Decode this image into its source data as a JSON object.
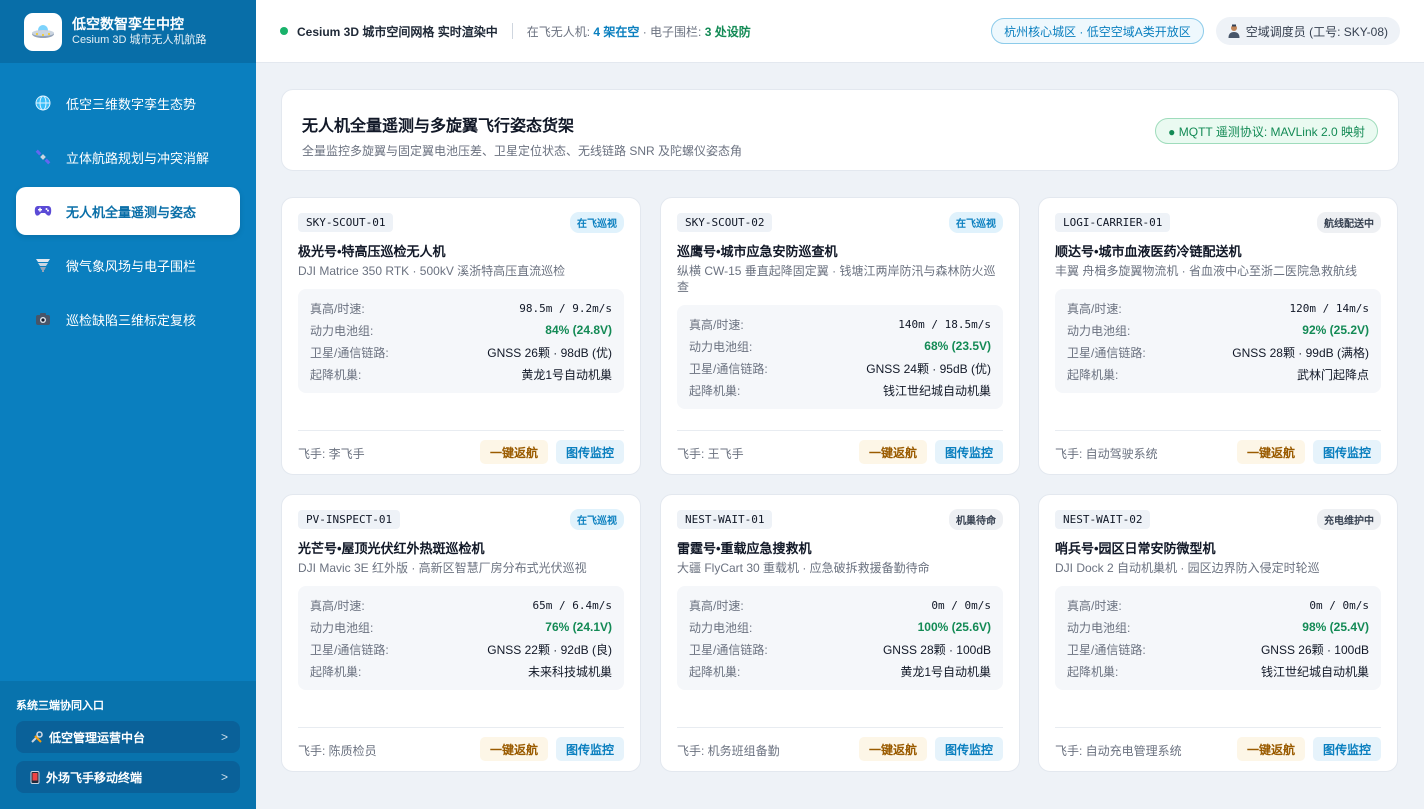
{
  "brand": {
    "title": "低空数智孪生中控",
    "subtitle": "Cesium 3D 城市无人机航路"
  },
  "nav": [
    {
      "label": "低空三维数字孪生态势",
      "icon": "globe-icon"
    },
    {
      "label": "立体航路规划与冲突消解",
      "icon": "satellite-icon"
    },
    {
      "label": "无人机全量遥测与姿态",
      "icon": "gamepad-icon",
      "active": true
    },
    {
      "label": "微气象风场与电子围栏",
      "icon": "tornado-icon"
    },
    {
      "label": "巡检缺陷三维标定复核",
      "icon": "camera-icon"
    }
  ],
  "side_bottom": {
    "title": "系统三端协同入口",
    "links": [
      {
        "label": "低空管理运营中台",
        "icon": "tools-icon",
        "arrow": ">"
      },
      {
        "label": "外场飞手移动终端",
        "icon": "phone-icon",
        "arrow": ">"
      }
    ]
  },
  "topbar": {
    "live_text": "Cesium 3D 城市空间网格 实时渲染中",
    "stat_prefix": "在飞无人机: ",
    "flying": "4 架在空",
    "stat_mid": " · 电子围栏: ",
    "fences": "3 处设防",
    "zone": "杭州核心城区 · 低空空域A类开放区",
    "user": "空域调度员 (工号: SKY-08)"
  },
  "header": {
    "title": "无人机全量遥测与多旋翼飞行姿态货架",
    "subtitle": "全量监控多旋翼与固定翼电池压差、卫星定位状态、无线链路 SNR 及陀螺仪姿态角",
    "protocol": "● MQTT 遥测协议: MAVLink 2.0 映射"
  },
  "labels": {
    "alt_speed": "真高/时速:",
    "battery": "动力电池组:",
    "link": "卫星/通信链路:",
    "dock": "起降机巢:",
    "rth": "一键返航",
    "video": "图传监控"
  },
  "drones": [
    {
      "code": "SKY-SCOUT-01",
      "status": "在飞巡视",
      "flying": true,
      "name": "极光号•特高压巡检无人机",
      "desc": "DJI Matrice 350 RTK · 500kV 溪浙特高压直流巡检",
      "alt_speed": "98.5m / 9.2m/s",
      "battery": "84% (24.8V)",
      "link": "GNSS 26颗 · 98dB (优)",
      "dock": "黄龙1号自动机巢",
      "pilot": "飞手: 李飞手"
    },
    {
      "code": "SKY-SCOUT-02",
      "status": "在飞巡视",
      "flying": true,
      "name": "巡鹰号•城市应急安防巡查机",
      "desc": "纵横 CW-15 垂直起降固定翼 · 钱塘江两岸防汛与森林防火巡查",
      "alt_speed": "140m / 18.5m/s",
      "battery": "68% (23.5V)",
      "link": "GNSS 24颗 · 95dB (优)",
      "dock": "钱江世纪城自动机巢",
      "pilot": "飞手: 王飞手"
    },
    {
      "code": "LOGI-CARRIER-01",
      "status": "航线配送中",
      "flying": false,
      "name": "顺达号•城市血液医药冷链配送机",
      "desc": "丰翼 舟楫多旋翼物流机 · 省血液中心至浙二医院急救航线",
      "alt_speed": "120m / 14m/s",
      "battery": "92% (25.2V)",
      "link": "GNSS 28颗 · 99dB (满格)",
      "dock": "武林门起降点",
      "pilot": "飞手: 自动驾驶系统"
    },
    {
      "code": "PV-INSPECT-01",
      "status": "在飞巡视",
      "flying": true,
      "name": "光芒号•屋顶光伏红外热斑巡检机",
      "desc": "DJI Mavic 3E 红外版 · 高新区智慧厂房分布式光伏巡视",
      "alt_speed": "65m / 6.4m/s",
      "battery": "76% (24.1V)",
      "link": "GNSS 22颗 · 92dB (良)",
      "dock": "未来科技城机巢",
      "pilot": "飞手: 陈质检员"
    },
    {
      "code": "NEST-WAIT-01",
      "status": "机巢待命",
      "flying": false,
      "name": "雷霆号•重载应急搜救机",
      "desc": "大疆 FlyCart 30 重载机 · 应急破拆救援备勤待命",
      "alt_speed": "0m / 0m/s",
      "battery": "100% (25.6V)",
      "link": "GNSS 28颗 · 100dB",
      "dock": "黄龙1号自动机巢",
      "pilot": "飞手: 机务班组备勤"
    },
    {
      "code": "NEST-WAIT-02",
      "status": "充电维护中",
      "flying": false,
      "name": "哨兵号•园区日常安防微型机",
      "desc": "DJI Dock 2 自动机巢机 · 园区边界防入侵定时轮巡",
      "alt_speed": "0m / 0m/s",
      "battery": "98% (25.4V)",
      "link": "GNSS 26颗 · 100dB",
      "dock": "钱江世纪城自动机巢",
      "pilot": "飞手: 自动充电管理系统"
    }
  ],
  "colors": {
    "sidebar": "#0a7fbf",
    "accent": "#0a7fbf",
    "ok": "#138a55",
    "warn_btn": "#fdf6e7"
  }
}
